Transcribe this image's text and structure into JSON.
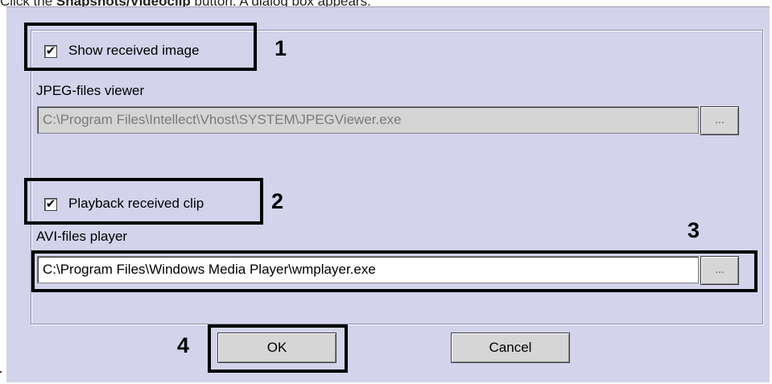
{
  "instruction": {
    "prefix": "Click the ",
    "bold": "Snapshots/Videoclip",
    "suffix": " button. A dialog box appears."
  },
  "dialog": {
    "show_image_label": "Show received image",
    "show_image_checked": true,
    "jpeg_viewer_label": "JPEG-files viewer",
    "jpeg_viewer_path": "C:\\Program Files\\Intellect\\Vhost\\SYSTEM\\JPEGViewer.exe",
    "browse_label": "...",
    "playback_clip_label": "Playback received clip",
    "playback_clip_checked": true,
    "avi_player_label": "AVI-files player",
    "avi_player_path": "C:\\Program Files\\Windows Media Player\\wmplayer.exe",
    "ok_label": "OK",
    "cancel_label": "Cancel"
  },
  "callouts": [
    "1",
    "2",
    "3",
    "4"
  ],
  "colors": {
    "dialog_bg": "#d3d3ec",
    "disabled_field_bg": "#d4d4d4",
    "highlight": "#000000"
  }
}
